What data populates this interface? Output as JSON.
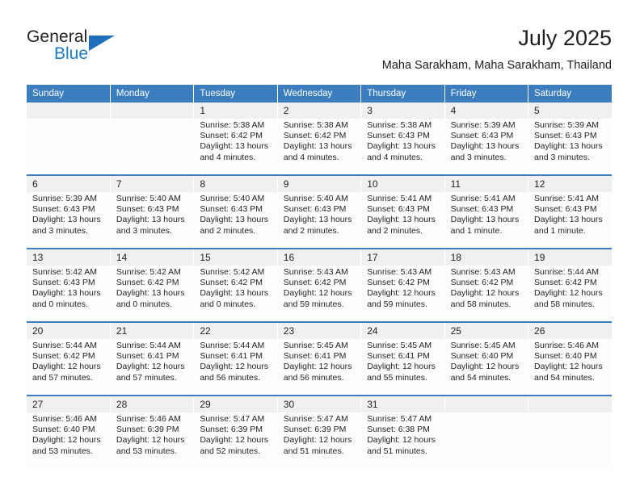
{
  "brand": {
    "name_top": "General",
    "name_bottom": "Blue",
    "accent_color": "#1f7ac4",
    "triangle_color": "#1f6fba"
  },
  "header": {
    "title": "July 2025",
    "subtitle": "Maha Sarakham, Maha Sarakham, Thailand"
  },
  "theme": {
    "header_bg": "#3b7dbe",
    "daynum_bg": "#f0f0f0",
    "cell_bg": "#fdfdfd",
    "text": "#231f20"
  },
  "weekdays": [
    "Sunday",
    "Monday",
    "Tuesday",
    "Wednesday",
    "Thursday",
    "Friday",
    "Saturday"
  ],
  "weeks": [
    {
      "days": [
        {
          "num": "",
          "lines": []
        },
        {
          "num": "",
          "lines": []
        },
        {
          "num": "1",
          "lines": [
            "Sunrise: 5:38 AM",
            "Sunset: 6:42 PM",
            "Daylight: 13 hours",
            "and 4 minutes."
          ]
        },
        {
          "num": "2",
          "lines": [
            "Sunrise: 5:38 AM",
            "Sunset: 6:42 PM",
            "Daylight: 13 hours",
            "and 4 minutes."
          ]
        },
        {
          "num": "3",
          "lines": [
            "Sunrise: 5:38 AM",
            "Sunset: 6:43 PM",
            "Daylight: 13 hours",
            "and 4 minutes."
          ]
        },
        {
          "num": "4",
          "lines": [
            "Sunrise: 5:39 AM",
            "Sunset: 6:43 PM",
            "Daylight: 13 hours",
            "and 3 minutes."
          ]
        },
        {
          "num": "5",
          "lines": [
            "Sunrise: 5:39 AM",
            "Sunset: 6:43 PM",
            "Daylight: 13 hours",
            "and 3 minutes."
          ]
        }
      ]
    },
    {
      "days": [
        {
          "num": "6",
          "lines": [
            "Sunrise: 5:39 AM",
            "Sunset: 6:43 PM",
            "Daylight: 13 hours",
            "and 3 minutes."
          ]
        },
        {
          "num": "7",
          "lines": [
            "Sunrise: 5:40 AM",
            "Sunset: 6:43 PM",
            "Daylight: 13 hours",
            "and 3 minutes."
          ]
        },
        {
          "num": "8",
          "lines": [
            "Sunrise: 5:40 AM",
            "Sunset: 6:43 PM",
            "Daylight: 13 hours",
            "and 2 minutes."
          ]
        },
        {
          "num": "9",
          "lines": [
            "Sunrise: 5:40 AM",
            "Sunset: 6:43 PM",
            "Daylight: 13 hours",
            "and 2 minutes."
          ]
        },
        {
          "num": "10",
          "lines": [
            "Sunrise: 5:41 AM",
            "Sunset: 6:43 PM",
            "Daylight: 13 hours",
            "and 2 minutes."
          ]
        },
        {
          "num": "11",
          "lines": [
            "Sunrise: 5:41 AM",
            "Sunset: 6:43 PM",
            "Daylight: 13 hours",
            "and 1 minute."
          ]
        },
        {
          "num": "12",
          "lines": [
            "Sunrise: 5:41 AM",
            "Sunset: 6:43 PM",
            "Daylight: 13 hours",
            "and 1 minute."
          ]
        }
      ]
    },
    {
      "days": [
        {
          "num": "13",
          "lines": [
            "Sunrise: 5:42 AM",
            "Sunset: 6:43 PM",
            "Daylight: 13 hours",
            "and 0 minutes."
          ]
        },
        {
          "num": "14",
          "lines": [
            "Sunrise: 5:42 AM",
            "Sunset: 6:42 PM",
            "Daylight: 13 hours",
            "and 0 minutes."
          ]
        },
        {
          "num": "15",
          "lines": [
            "Sunrise: 5:42 AM",
            "Sunset: 6:42 PM",
            "Daylight: 13 hours",
            "and 0 minutes."
          ]
        },
        {
          "num": "16",
          "lines": [
            "Sunrise: 5:43 AM",
            "Sunset: 6:42 PM",
            "Daylight: 12 hours",
            "and 59 minutes."
          ]
        },
        {
          "num": "17",
          "lines": [
            "Sunrise: 5:43 AM",
            "Sunset: 6:42 PM",
            "Daylight: 12 hours",
            "and 59 minutes."
          ]
        },
        {
          "num": "18",
          "lines": [
            "Sunrise: 5:43 AM",
            "Sunset: 6:42 PM",
            "Daylight: 12 hours",
            "and 58 minutes."
          ]
        },
        {
          "num": "19",
          "lines": [
            "Sunrise: 5:44 AM",
            "Sunset: 6:42 PM",
            "Daylight: 12 hours",
            "and 58 minutes."
          ]
        }
      ]
    },
    {
      "days": [
        {
          "num": "20",
          "lines": [
            "Sunrise: 5:44 AM",
            "Sunset: 6:42 PM",
            "Daylight: 12 hours",
            "and 57 minutes."
          ]
        },
        {
          "num": "21",
          "lines": [
            "Sunrise: 5:44 AM",
            "Sunset: 6:41 PM",
            "Daylight: 12 hours",
            "and 57 minutes."
          ]
        },
        {
          "num": "22",
          "lines": [
            "Sunrise: 5:44 AM",
            "Sunset: 6:41 PM",
            "Daylight: 12 hours",
            "and 56 minutes."
          ]
        },
        {
          "num": "23",
          "lines": [
            "Sunrise: 5:45 AM",
            "Sunset: 6:41 PM",
            "Daylight: 12 hours",
            "and 56 minutes."
          ]
        },
        {
          "num": "24",
          "lines": [
            "Sunrise: 5:45 AM",
            "Sunset: 6:41 PM",
            "Daylight: 12 hours",
            "and 55 minutes."
          ]
        },
        {
          "num": "25",
          "lines": [
            "Sunrise: 5:45 AM",
            "Sunset: 6:40 PM",
            "Daylight: 12 hours",
            "and 54 minutes."
          ]
        },
        {
          "num": "26",
          "lines": [
            "Sunrise: 5:46 AM",
            "Sunset: 6:40 PM",
            "Daylight: 12 hours",
            "and 54 minutes."
          ]
        }
      ]
    },
    {
      "days": [
        {
          "num": "27",
          "lines": [
            "Sunrise: 5:46 AM",
            "Sunset: 6:40 PM",
            "Daylight: 12 hours",
            "and 53 minutes."
          ]
        },
        {
          "num": "28",
          "lines": [
            "Sunrise: 5:46 AM",
            "Sunset: 6:39 PM",
            "Daylight: 12 hours",
            "and 53 minutes."
          ]
        },
        {
          "num": "29",
          "lines": [
            "Sunrise: 5:47 AM",
            "Sunset: 6:39 PM",
            "Daylight: 12 hours",
            "and 52 minutes."
          ]
        },
        {
          "num": "30",
          "lines": [
            "Sunrise: 5:47 AM",
            "Sunset: 6:39 PM",
            "Daylight: 12 hours",
            "and 51 minutes."
          ]
        },
        {
          "num": "31",
          "lines": [
            "Sunrise: 5:47 AM",
            "Sunset: 6:38 PM",
            "Daylight: 12 hours",
            "and 51 minutes."
          ]
        },
        {
          "num": "",
          "lines": []
        },
        {
          "num": "",
          "lines": []
        }
      ]
    }
  ]
}
